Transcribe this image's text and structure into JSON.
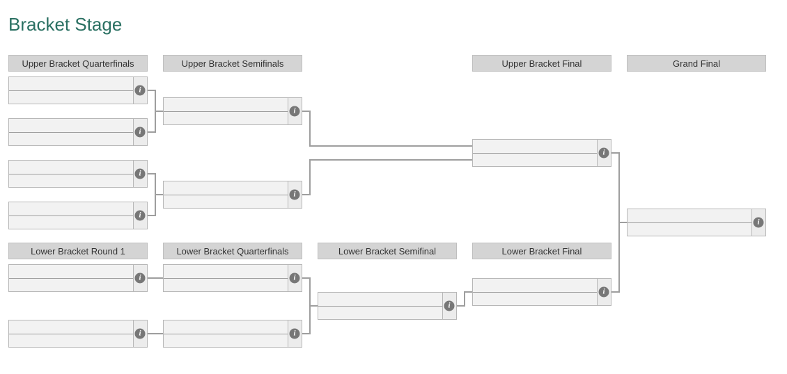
{
  "title": "Bracket Stage",
  "headers": {
    "ub_qf": "Upper Bracket Quarterfinals",
    "ub_sf": "Upper Bracket Semifinals",
    "ub_f": "Upper Bracket Final",
    "gf": "Grand Final",
    "lb_r1": "Lower Bracket Round 1",
    "lb_qf": "Lower Bracket Quarterfinals",
    "lb_sf": "Lower Bracket Semifinal",
    "lb_f": "Lower Bracket Final"
  },
  "info_glyph": "i"
}
